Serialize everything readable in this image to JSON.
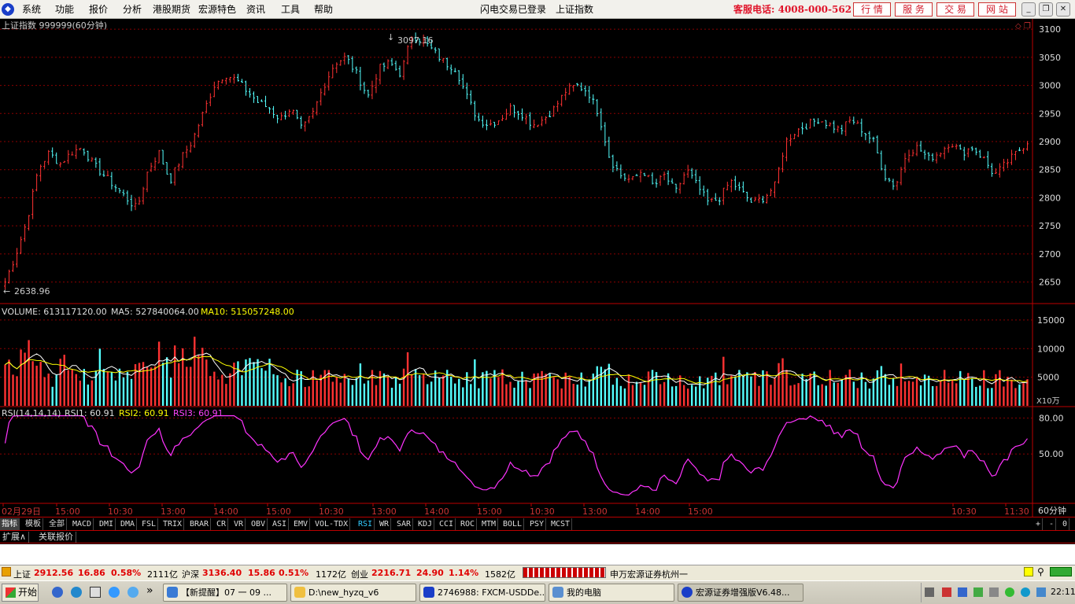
{
  "menu": {
    "items": [
      "系统",
      "功能",
      "报价",
      "分析",
      "港股期货",
      "宏源特色",
      "资讯",
      "工具",
      "帮助"
    ],
    "login_status": "闪电交易已登录",
    "current_security": "上证指数",
    "hotline": "客服电话: 4008-000-562",
    "top_buttons": [
      "行 情",
      "服 务",
      "交 易",
      "网 站"
    ]
  },
  "chart": {
    "title": "上证指数 999999(60分钟)",
    "high_label": "3097.16",
    "low_label": "2638.96",
    "price_ticks": [
      "3100",
      "3050",
      "3000",
      "2950",
      "2900",
      "2850",
      "2800",
      "2750",
      "2700",
      "2650"
    ],
    "volume": {
      "label": "VOLUME: 613117120.00",
      "ma5": "MA5: 527840064.00",
      "ma10": "MA10: 515057248.00",
      "ticks": [
        "15000",
        "10000",
        "5000"
      ],
      "unit": "X10万"
    },
    "rsi": {
      "label": "RSI(14,14,14)",
      "rsi1": "RSI1: 60.91",
      "rsi2": "RSI2: 60.91",
      "rsi3": "RSI3: 60.91",
      "ticks": [
        "80.00",
        "50.00"
      ]
    },
    "time_labels": [
      "02月29日",
      "15:00",
      "10:30",
      "13:00",
      "14:00",
      "15:00",
      "10:30",
      "13:00",
      "14:00",
      "15:00",
      "10:30",
      "13:00",
      "14:00",
      "15:00",
      "10:30",
      "11:30"
    ],
    "period": "60分钟",
    "colors": {
      "up": "#ff3232",
      "down": "#54ffff",
      "ma5": "#ffffff",
      "ma10": "#ffff00",
      "rsi": "#ff33ff",
      "grid": "#8b0000"
    }
  },
  "chart_data": {
    "type": "candlestick",
    "title": "上证指数 999999(60分钟)",
    "ylim": [
      2620,
      3110
    ],
    "high": 3097.16,
    "low": 2638.96,
    "approx_close_path": [
      2650,
      2700,
      2760,
      2850,
      2880,
      2860,
      2880,
      2890,
      2860,
      2840,
      2820,
      2800,
      2780,
      2850,
      2880,
      2830,
      2870,
      2900,
      2950,
      3000,
      3020,
      3010,
      2990,
      2970,
      2960,
      2940,
      2960,
      2920,
      2950,
      3000,
      3040,
      3050,
      3020,
      2980,
      3030,
      3040,
      3020,
      3090,
      3080,
      3060,
      3040,
      3030,
      2980,
      2940,
      2930,
      2940,
      2960,
      2950,
      2930,
      2940,
      2960,
      2990,
      3000,
      2990,
      2950,
      2870,
      2840,
      2830,
      2850,
      2820,
      2840,
      2810,
      2850,
      2820,
      2790,
      2800,
      2830,
      2810,
      2790,
      2800,
      2820,
      2900,
      2920,
      2930,
      2940,
      2930,
      2920,
      2940,
      2920,
      2900,
      2840,
      2820,
      2880,
      2890,
      2870,
      2880,
      2900,
      2880,
      2890,
      2870,
      2840,
      2860,
      2880,
      2900
    ]
  },
  "indicators": {
    "tabs": [
      "指标",
      "模板",
      "全部",
      "MACD",
      "DMI",
      "DMA",
      "FSL",
      "TRIX",
      "BRAR",
      "CR",
      "VR",
      "OBV",
      "ASI",
      "EMV",
      "VOL-TDX",
      "RSI",
      "WR",
      "SAR",
      "KDJ",
      "CCI",
      "ROC",
      "MTM",
      "BOLL",
      "PSY",
      "MCST"
    ],
    "right": [
      "+",
      "-",
      "0"
    ]
  },
  "subtabs": [
    "扩展∧",
    "关联报价"
  ],
  "status": {
    "sh_name": "上证",
    "sh_val": "2912.56",
    "sh_chg": "16.86",
    "sh_pct": "0.58%",
    "sh_amt": "2111亿",
    "hs_name": "沪深",
    "hs_val": "3136.40",
    "hs_chg": "15.86",
    "hs_pct": "0.51%",
    "hs_amt": "1172亿",
    "cy_name": "创业",
    "cy_val": "2216.71",
    "cy_chg": "24.90",
    "cy_pct": "1.14%",
    "cy_amt": "1582亿",
    "broker": "申万宏源证券杭州一"
  },
  "taskbar": {
    "start": "开始",
    "tasks": [
      "【新提醒】07 一 09 ...",
      "D:\\new_hyzq_v6",
      "2746988: FXCM-USDDe...",
      "我的电脑",
      "宏源证券增强版V6.48..."
    ],
    "clock": "22:11"
  }
}
